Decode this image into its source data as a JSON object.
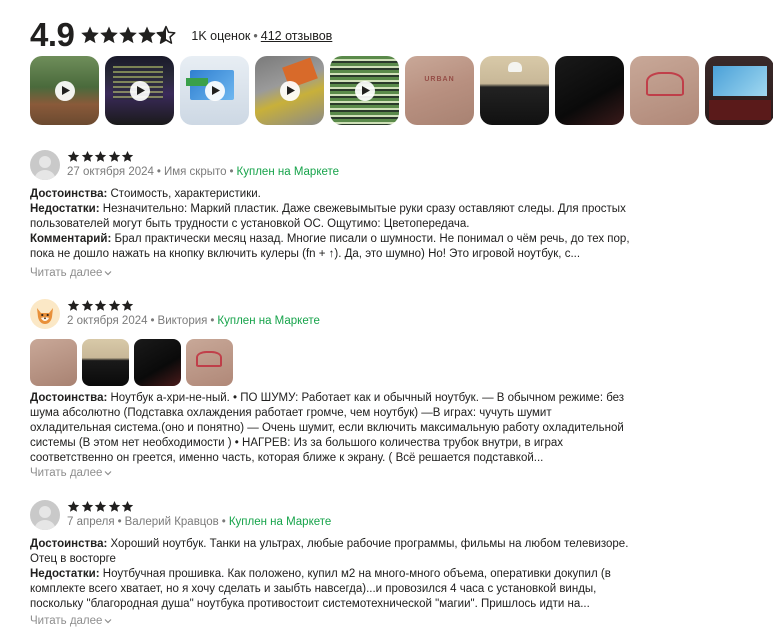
{
  "summary": {
    "rating": "4.9",
    "ratings_count": "1K оценок",
    "separator": "•",
    "reviews_link": "412 отзывов",
    "stars_value": 4.9
  },
  "media": [
    {
      "kind": "video",
      "icon": "play-icon"
    },
    {
      "kind": "video",
      "icon": "play-icon"
    },
    {
      "kind": "video",
      "icon": "play-icon"
    },
    {
      "kind": "video",
      "icon": "play-icon"
    },
    {
      "kind": "video",
      "icon": "play-icon"
    },
    {
      "kind": "photo",
      "label": "URBAN"
    },
    {
      "kind": "photo"
    },
    {
      "kind": "photo"
    },
    {
      "kind": "photo"
    },
    {
      "kind": "photo"
    }
  ],
  "colors": {
    "star": "#21201f",
    "bought": "#16a34a",
    "meta": "#7b7b7b",
    "more": "#8e8e8e"
  },
  "reviews": [
    {
      "stars": 5,
      "date": "27 октября 2024",
      "author": "Имя скрыто",
      "bought": "Куплен на Маркете",
      "pros_label": "Достоинства:",
      "pros": "Стоимость, характеристики.",
      "cons_label": "Недостатки:",
      "cons": "Незначительно: Маркий пластик. Даже свежевымытые руки сразу оставляют следы. Для простых пользователей могут быть трудности с установкой ОС. Ощутимо: Цветопередача.",
      "comment_label": "Комментарий:",
      "comment": "Брал практически месяц назад. Многие писали о шумности. Не понимал о чём речь, до тех пор, пока не дошло нажать на кнопку включить кулеры (fn + ↑). Да, это шумно) Но! Это игровой ноутбук, с...",
      "more": "Читать далее"
    },
    {
      "stars": 5,
      "date": "2 октября 2024",
      "author": "Виктория",
      "bought": "Куплен на Маркете",
      "pros_label": "Достоинства:",
      "pros": "Ноутбук а-хри-не-ный. • ПО ШУМУ: Работает как и обычный ноутбук. — В обычном режиме: без шума абсолютно (Подставка охлаждения работает громче, чем ноутбук) —В играх: чучуть шумит охладительная система.(оно и понятно) — Очень шумит, если включить максимальную работу охладительной системы (В этом нет необходимости ) • НАГРЕВ: Из за большого количества трубок внутри, в играх соответственно он греется, именно часть, которая ближе к экрану. ( Всё решается подставкой...",
      "more": "Читать далее"
    },
    {
      "stars": 5,
      "date": "7 апреля",
      "author": "Валерий Кравцов",
      "bought": "Куплен на Маркете",
      "pros_label": "Достоинства:",
      "pros": "Хороший ноутбук. Танки на ультрах, любые рабочие программы, фильмы на любом телевизоре. Отец в восторге",
      "cons_label": "Недостатки:",
      "cons": "Ноутбучная прошивка. Как положено, купил м2 на много-много объема, оперативки докупил (в комплекте всего хватает, но я хочу сделать и заыбть навсегда)...и провозился 4 часа с установкой винды, поскольку \"благородная душа\" ноутбука противостоит системотехнической \"магии\". Пришлось идти на...",
      "more": "Читать далее"
    }
  ]
}
